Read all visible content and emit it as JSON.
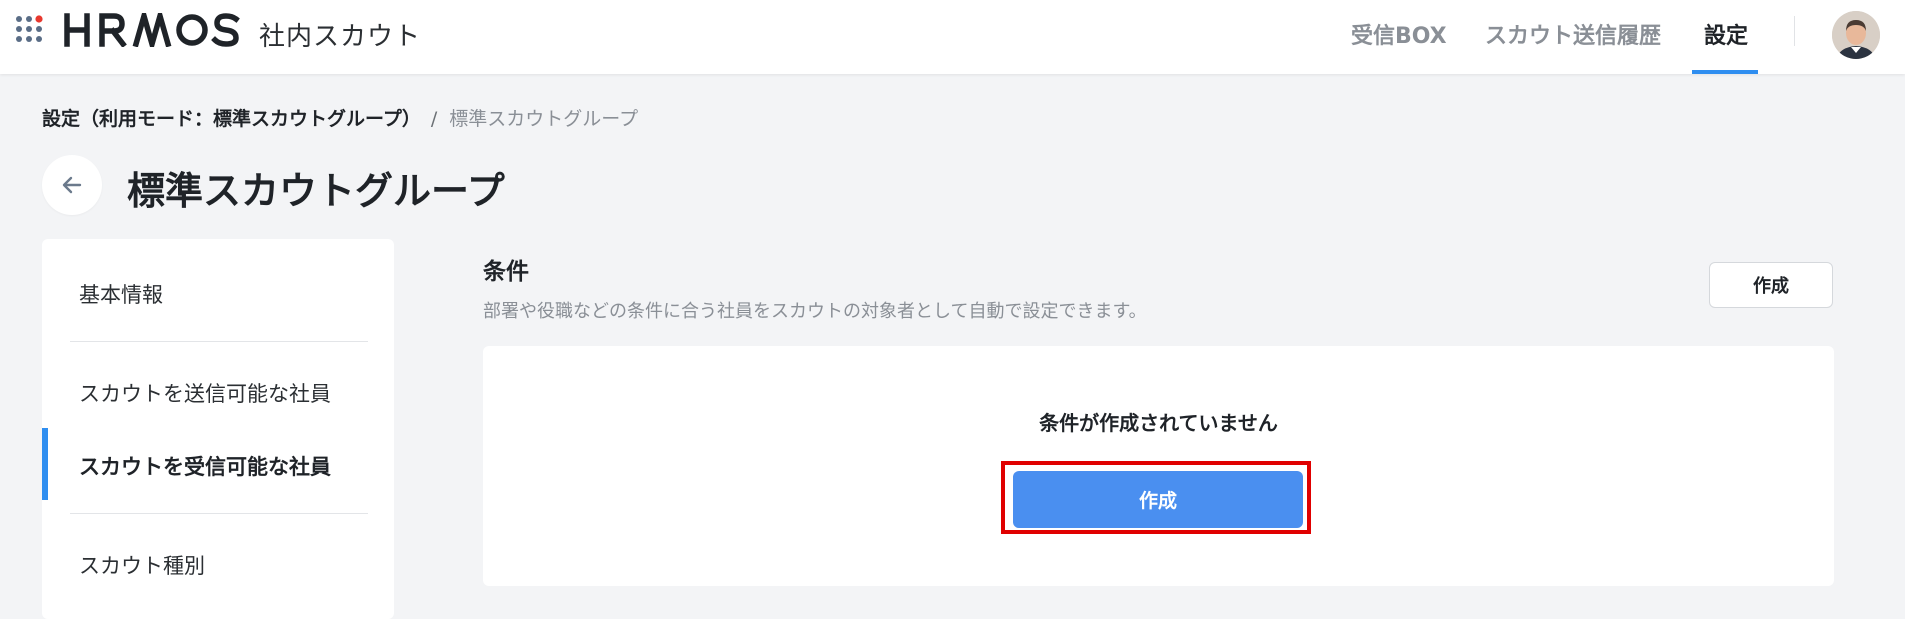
{
  "header": {
    "logo_text": "HRMOS",
    "product_name": "社内スカウト",
    "nav": {
      "inbox": "受信BOX",
      "history": "スカウト送信履歴",
      "settings": "設定"
    },
    "accent_color": "#2f8ef0"
  },
  "breadcrumb": {
    "parent": "設定（利用モード：標準スカウトグループ）",
    "separator": "/",
    "current": "標準スカウトグループ"
  },
  "page": {
    "title": "標準スカウトグループ"
  },
  "side_menu": {
    "items": [
      {
        "label": "基本情報",
        "active": false
      },
      {
        "label": "スカウトを送信可能な社員",
        "active": false
      },
      {
        "label": "スカウトを受信可能な社員",
        "active": true
      },
      {
        "label": "スカウト種別",
        "active": false
      }
    ]
  },
  "conditions": {
    "title": "条件",
    "description": "部署や役職などの条件に合う社員をスカウトの対象者として自動で設定できます。",
    "create_button": "作成",
    "empty_message": "条件が作成されていません",
    "empty_create_button": "作成"
  },
  "icons": [
    "apps-grid-icon",
    "back-arrow-icon",
    "user-avatar"
  ],
  "colors": {
    "primary_button": "#4a8ff0",
    "highlight_border": "#e00000",
    "logo_dot_red": "#e8382e",
    "logo_dot_gray": "#5a6d86"
  }
}
